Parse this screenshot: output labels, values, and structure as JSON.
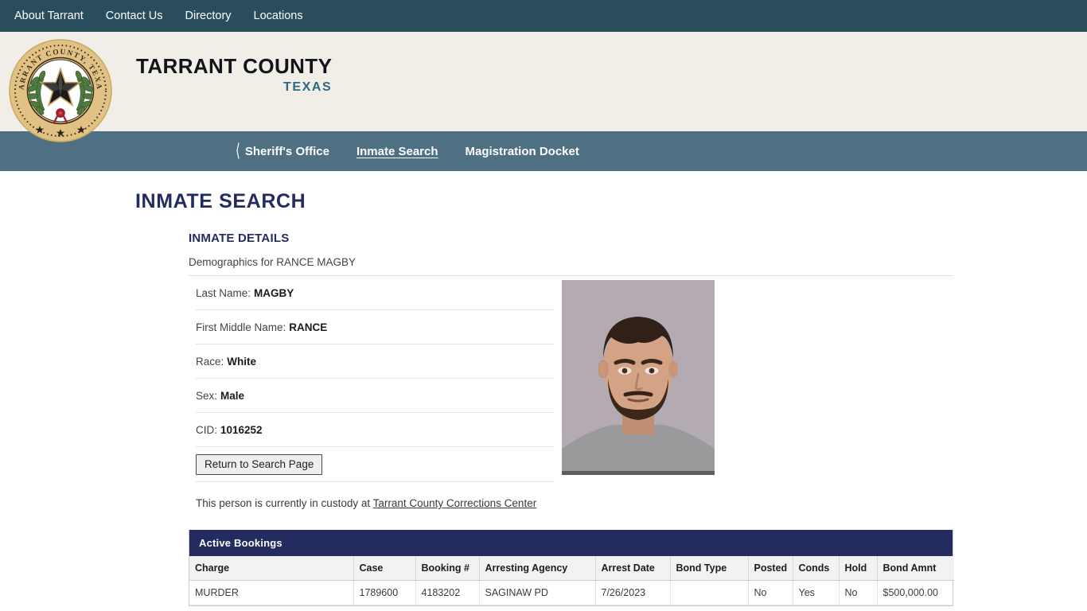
{
  "utility_nav": {
    "items": [
      {
        "label": "About Tarrant"
      },
      {
        "label": "Contact Us"
      },
      {
        "label": "Directory"
      },
      {
        "label": "Locations"
      }
    ]
  },
  "brand": {
    "title": "TARRANT COUNTY",
    "subtitle": "TEXAS",
    "seal_alt": "Tarrant County Texas seal",
    "seal_ring_text": "TARRANT COUNTY, TEXAS",
    "colors": {
      "utility_bar": "#2a4d5e",
      "brand_band": "#f1eee8",
      "section_nav": "#4f7082",
      "brand_sub": "#2a6a80",
      "navy": "#232b5f",
      "seal_gold": "#e3c municipality"
    }
  },
  "section_nav": {
    "items": [
      {
        "label": "Sheriff's Office",
        "icon": "chevron-left-icon",
        "active": false
      },
      {
        "label": "Inmate Search",
        "icon": "",
        "active": true
      },
      {
        "label": "Magistration Docket",
        "icon": "",
        "active": false
      }
    ]
  },
  "page": {
    "title": "INMATE SEARCH",
    "details_heading": "INMATE DETAILS",
    "demographics_line": "Demographics for RANCE MAGBY"
  },
  "inmate": {
    "rows": [
      {
        "label": "Last Name:",
        "value": "MAGBY"
      },
      {
        "label": "First Middle Name:",
        "value": "RANCE"
      },
      {
        "label": "Race:",
        "value": "White"
      },
      {
        "label": "Sex:",
        "value": "Male"
      },
      {
        "label": "CID:",
        "value": "1016252"
      }
    ],
    "return_button": "Return to Search Page",
    "custody_prefix": "This person is currently in custody at ",
    "custody_facility": "Tarrant County Corrections Center"
  },
  "bookings": {
    "title": "Active Bookings",
    "columns": [
      "Charge",
      "Case",
      "Booking #",
      "Arresting Agency",
      "Arrest Date",
      "Bond Type",
      "Posted",
      "Conds",
      "Hold",
      "Bond Amnt"
    ],
    "rows": [
      {
        "charge": "MURDER",
        "case": "1789600",
        "booking": "4183202",
        "agency": "SAGINAW PD",
        "arrest_date": "7/26/2023",
        "bond_type": "",
        "posted": "No",
        "conds": "Yes",
        "hold": "No",
        "bond_amnt": "$500,000.00"
      }
    ]
  }
}
